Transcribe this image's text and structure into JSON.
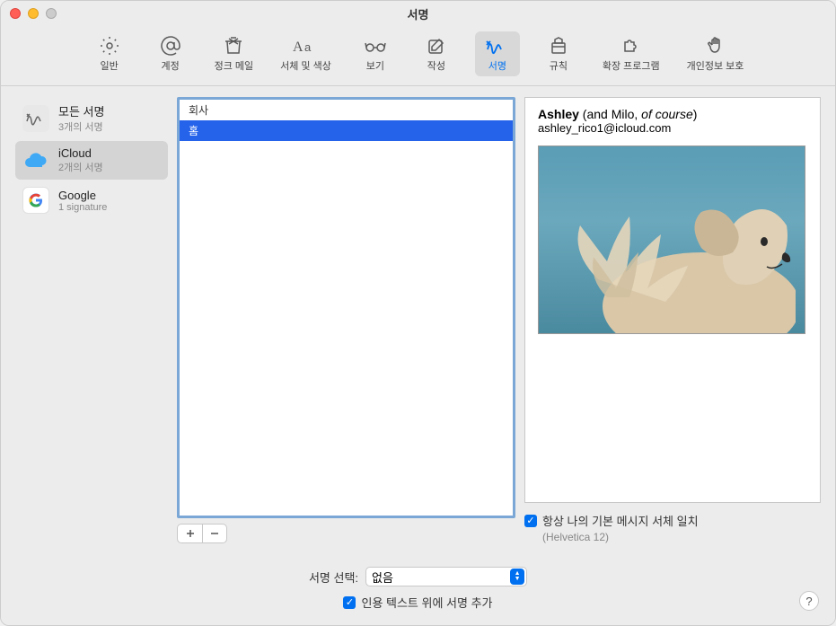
{
  "window": {
    "title": "서명"
  },
  "toolbar": {
    "items": [
      {
        "label": "일반",
        "icon": "gear"
      },
      {
        "label": "계정",
        "icon": "at"
      },
      {
        "label": "정크 메일",
        "icon": "trash"
      },
      {
        "label": "서체 및 색상",
        "icon": "aa"
      },
      {
        "label": "보기",
        "icon": "glasses"
      },
      {
        "label": "작성",
        "icon": "compose"
      },
      {
        "label": "서명",
        "icon": "signature",
        "selected": true
      },
      {
        "label": "규칙",
        "icon": "rules"
      },
      {
        "label": "확장 프로그램",
        "icon": "puzzle"
      },
      {
        "label": "개인정보 보호",
        "icon": "hand"
      }
    ]
  },
  "sidebar": {
    "items": [
      {
        "title": "모든 서명",
        "sub": "3개의 서명",
        "icon": "signature"
      },
      {
        "title": "iCloud",
        "sub": "2개의 서명",
        "icon": "cloud",
        "selected": true
      },
      {
        "title": "Google",
        "sub": "1 signature",
        "icon": "google"
      }
    ]
  },
  "signatureList": {
    "items": [
      {
        "name": "회사"
      },
      {
        "name": "홈",
        "selected": true
      }
    ]
  },
  "preview": {
    "name_bold": "Ashley",
    "name_paren_prefix": " (and Milo, ",
    "name_italic": "of course",
    "name_paren_suffix": ")",
    "email": "ashley_rico1@icloud.com"
  },
  "options": {
    "match_font_label": "항상 나의 기본 메시지 서체 일치",
    "font_info": "(Helvetica 12)",
    "match_font_checked": true
  },
  "bottom": {
    "select_label": "서명 선택:",
    "select_value": "없음",
    "place_above_label": "인용 텍스트 위에 서명 추가",
    "place_above_checked": true
  }
}
